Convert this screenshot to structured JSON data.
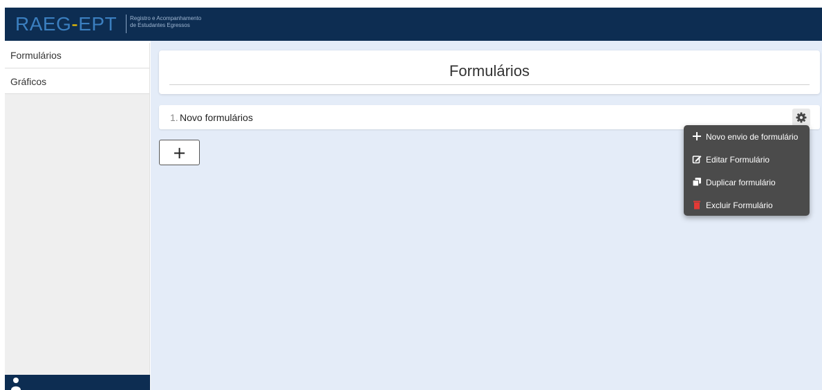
{
  "header": {
    "brand_left": "RAEG",
    "brand_dash": "-",
    "brand_right": "EPT",
    "subtitle_line1": "Registro e Acompanhamento",
    "subtitle_line2": "de Estudantes Egressos"
  },
  "sidebar": {
    "items": [
      {
        "label": "Formulários"
      },
      {
        "label": "Gráficos"
      }
    ],
    "user_icon": "user-icon"
  },
  "main": {
    "title": "Formulários",
    "forms": [
      {
        "index": "1.",
        "name": "Novo formulários"
      }
    ],
    "add_button_label": "+",
    "settings_icon": "gear-icon"
  },
  "context_menu": {
    "items": [
      {
        "label": "Novo envio de formulário",
        "icon": "plus-icon",
        "color": "#ffffff"
      },
      {
        "label": "Editar Formulário",
        "icon": "edit-icon",
        "color": "#ffffff"
      },
      {
        "label": "Duplicar formulário",
        "icon": "copy-icon",
        "color": "#ffffff"
      },
      {
        "label": "Excluir Formulário",
        "icon": "trash-icon",
        "color": "#e53935"
      }
    ]
  },
  "colors": {
    "header_bg": "#0d2d52",
    "brand_blue": "#3b7fc0",
    "brand_yellow": "#f2c400",
    "main_bg": "#e4ecf8",
    "menu_bg": "#4b4b4b",
    "danger": "#e53935"
  }
}
